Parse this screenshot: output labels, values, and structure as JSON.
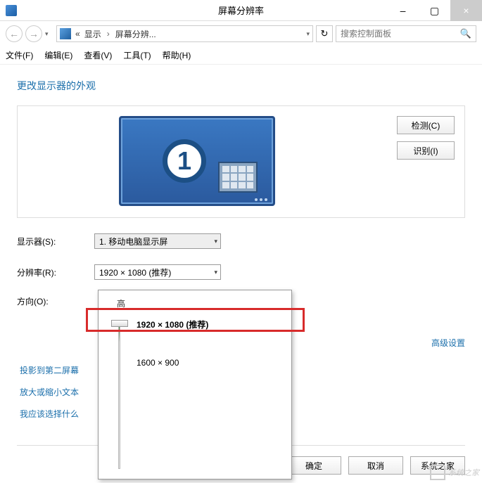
{
  "window": {
    "title": "屏幕分辨率",
    "minimize_label": "–",
    "maximize_label": "▢",
    "close_label": "×"
  },
  "nav": {
    "back_glyph": "←",
    "forward_glyph": "→",
    "dropdown_glyph": "▾",
    "refresh_glyph": "↻",
    "breadcrumb_prefix": "«",
    "crumb1": "显示",
    "crumb_sep": "›",
    "crumb2": "屏幕分辨...",
    "address_dd": "▾"
  },
  "search": {
    "placeholder": "搜索控制面板",
    "icon_glyph": "🔍"
  },
  "menu": {
    "file": "文件(F)",
    "edit": "编辑(E)",
    "view": "查看(V)",
    "tools": "工具(T)",
    "help": "帮助(H)"
  },
  "page": {
    "heading": "更改显示器的外观",
    "monitor_number": "1",
    "detect_btn": "检测(C)",
    "identify_btn": "识别(I)",
    "display_label": "显示器(S):",
    "display_value": "1. 移动电脑显示屏",
    "resolution_label": "分辨率(R):",
    "resolution_value": "1920 × 1080 (推荐)",
    "orientation_label": "方向(O):",
    "advanced_link": "高级设置",
    "link_project": "投影到第二屏幕",
    "link_text_size": "放大或缩小文本",
    "link_choose": "我应该选择什么",
    "ok_btn": "确定",
    "cancel_btn": "取消",
    "apply_btn": "系统之家"
  },
  "resolution_dropdown": {
    "high_label": "高",
    "option_selected": "1920 × 1080 (推荐)",
    "option_alt": "1600 × 900"
  },
  "select_glyph": "▾",
  "watermark": "系统之家"
}
